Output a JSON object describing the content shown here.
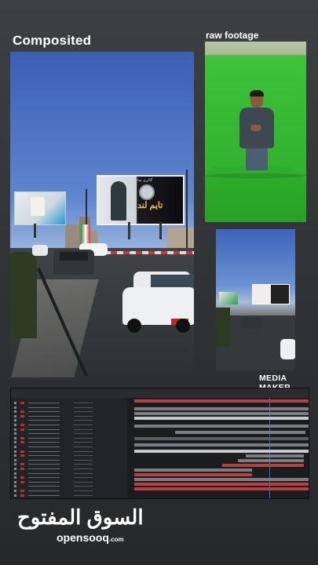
{
  "labels": {
    "composited": "Composited",
    "raw_footage": "raw footage",
    "media_maker": "MEDIA MAKER"
  },
  "composite_scene": {
    "billboard_small_text": "گالری ساعت",
    "billboard_main_text": "تایم لند"
  },
  "watermark": {
    "arabic": "السوق المفتوح",
    "latin": "opensooq",
    "suffix": ".com"
  },
  "colors": {
    "background": "#2f3134",
    "green_screen": "#34b531",
    "timeline_bar_red": "#b84040",
    "timeline_bar_gray": "#7a7d82",
    "playhead": "#3c66d8"
  }
}
